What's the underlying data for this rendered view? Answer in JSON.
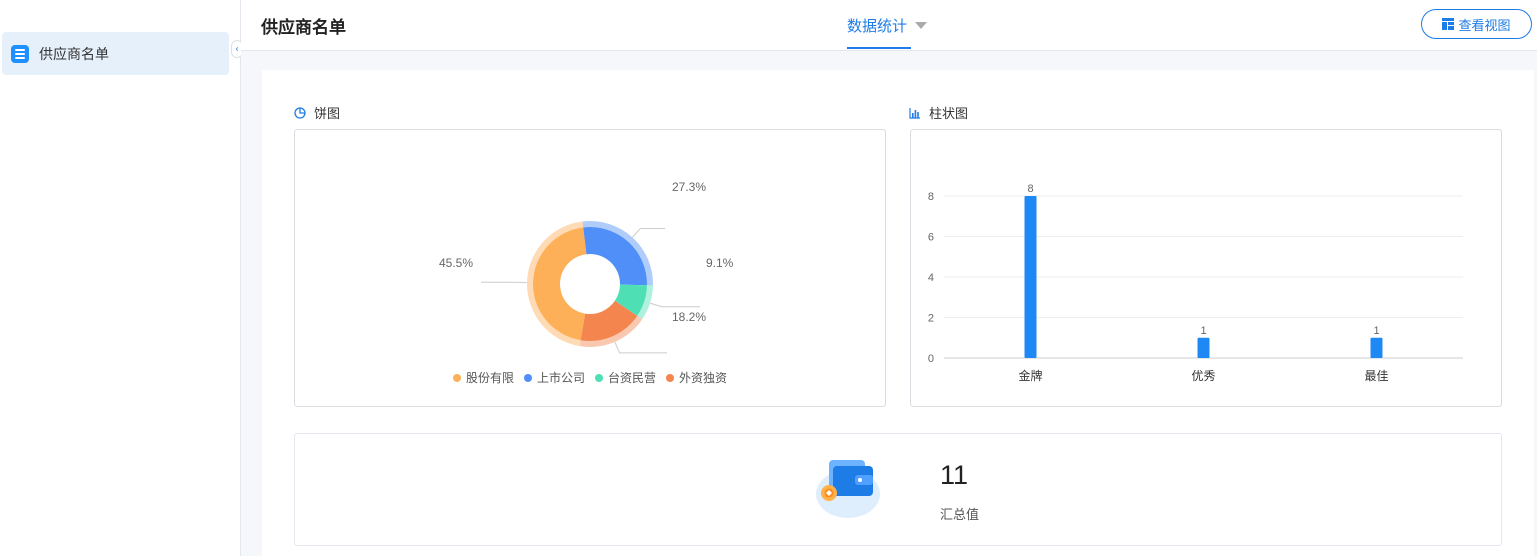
{
  "sidebar": {
    "items": [
      {
        "label": "供应商名单",
        "icon": "list-icon",
        "active": true
      }
    ]
  },
  "header": {
    "title": "供应商名单",
    "tab_label": "数据统计",
    "view_button_label": "查看视图"
  },
  "pie_section": {
    "title": "饼图",
    "chart_data": {
      "type": "pie",
      "donut": true,
      "slices": [
        {
          "name": "上市公司",
          "value": 27.3,
          "label": "27.3%",
          "color": "#4f8ff7"
        },
        {
          "name": "台资民营",
          "value": 9.1,
          "label": "9.1%",
          "color": "#4ee0b4"
        },
        {
          "name": "外资独资",
          "value": 18.2,
          "label": "18.2%",
          "color": "#f5854f"
        },
        {
          "name": "股份有限",
          "value": 45.5,
          "label": "45.5%",
          "color": "#fdb058"
        }
      ],
      "legend": [
        "股份有限",
        "上市公司",
        "台资民营",
        "外资独资"
      ],
      "legend_position": "bottom"
    }
  },
  "bar_section": {
    "title": "柱状图",
    "chart_data": {
      "type": "bar",
      "categories": [
        "金牌",
        "优秀",
        "最佳"
      ],
      "values": [
        8,
        1,
        1
      ],
      "yticks": [
        0,
        2,
        4,
        6,
        8
      ],
      "ylim": [
        0,
        8
      ],
      "grid": true,
      "bar_color": "#1e88f5"
    }
  },
  "summary": {
    "value": "11",
    "label": "汇总值",
    "icon": "wallet-icon"
  }
}
